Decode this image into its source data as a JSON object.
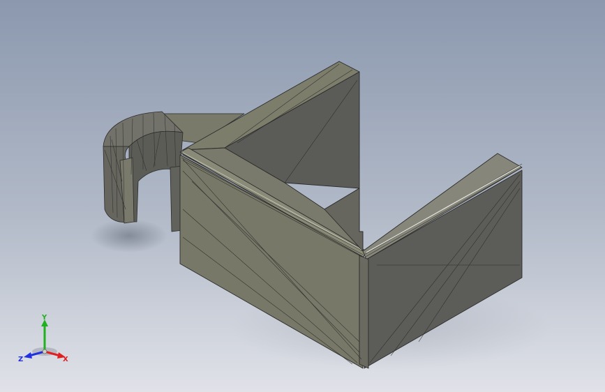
{
  "viewport": {
    "background_top": "#8e9bb0",
    "background_bottom": "#dde0e7"
  },
  "model": {
    "name": "",
    "face_light": "#7b7b6b",
    "face_mid": "#727264",
    "face_dark": "#5a5a58",
    "edge_color": "#2b2b2a"
  },
  "triad": {
    "x_label": "X",
    "y_label": "Y",
    "z_label": "Z",
    "x_color": "#e02020",
    "y_color": "#20b020",
    "z_color": "#2030e0"
  }
}
